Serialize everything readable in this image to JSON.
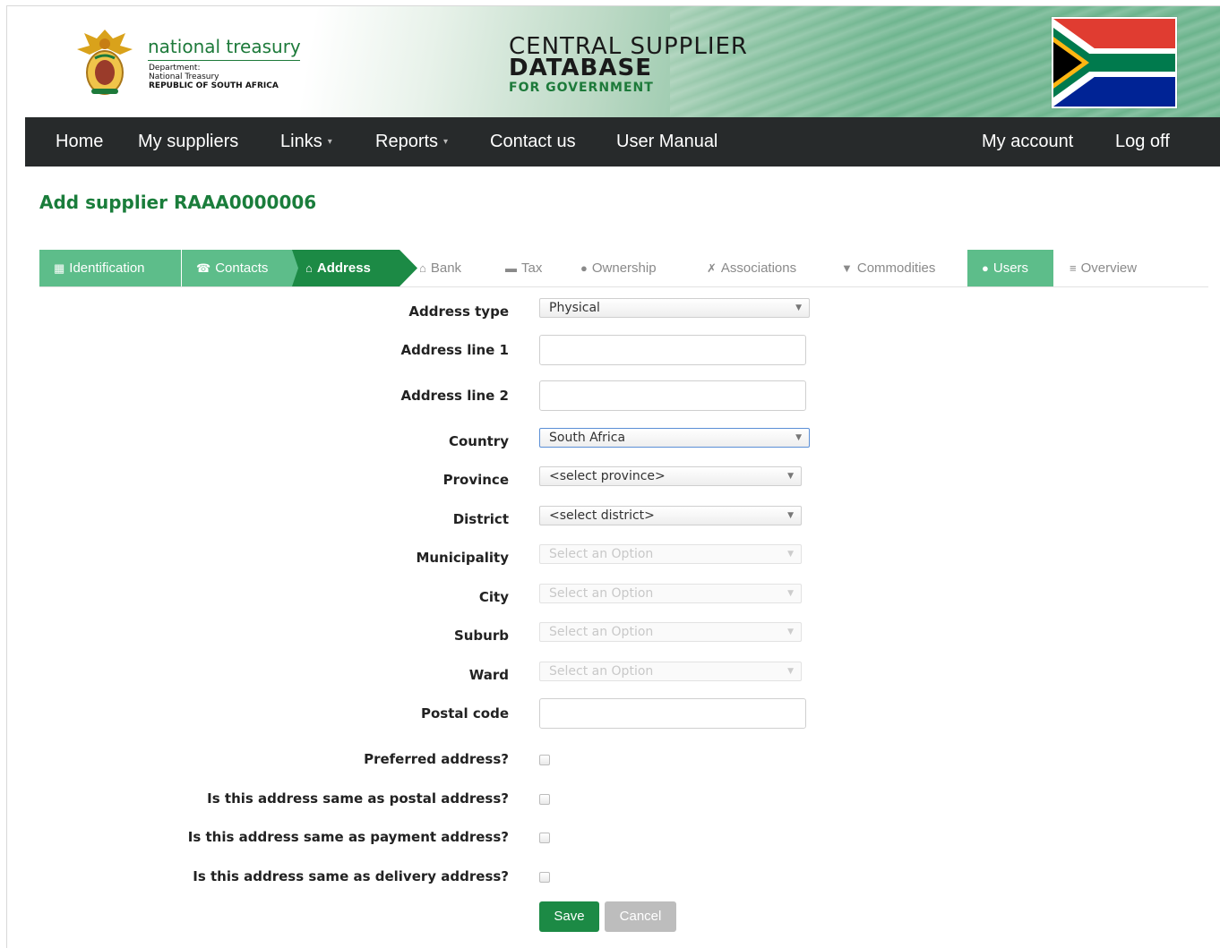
{
  "header": {
    "org_name": "national treasury",
    "org_sub1": "Department:",
    "org_sub2": "National Treasury",
    "org_sub3": "REPUBLIC OF SOUTH AFRICA",
    "csd_line1": "CENTRAL SUPPLIER",
    "csd_line2": "DATABASE",
    "csd_line3": "FOR GOVERNMENT"
  },
  "nav": {
    "home": "Home",
    "my_suppliers": "My suppliers",
    "links": "Links",
    "reports": "Reports",
    "contact": "Contact us",
    "manual": "User Manual",
    "account": "My account",
    "logoff": "Log off"
  },
  "page": {
    "title": "Add supplier RAAA0000006"
  },
  "steps": {
    "identification": "Identification",
    "contacts": "Contacts",
    "address": "Address",
    "bank": "Bank",
    "tax": "Tax",
    "ownership": "Ownership",
    "associations": "Associations",
    "commodities": "Commodities",
    "users": "Users",
    "overview": "Overview"
  },
  "form": {
    "address_type_label": "Address type",
    "address_type_value": "Physical",
    "line1_label": "Address line 1",
    "line2_label": "Address line 2",
    "country_label": "Country",
    "country_value": "South Africa",
    "province_label": "Province",
    "province_value": "<select province>",
    "district_label": "District",
    "district_value": "<select district>",
    "municipality_label": "Municipality",
    "city_label": "City",
    "suburb_label": "Suburb",
    "ward_label": "Ward",
    "option_placeholder": "Select an Option",
    "postal_label": "Postal code",
    "preferred_label": "Preferred address?",
    "same_postal_label": "Is this address same as postal address?",
    "same_payment_label": "Is this address same as payment address?",
    "same_delivery_label": "Is this address same as delivery address?"
  },
  "buttons": {
    "save": "Save",
    "cancel": "Cancel"
  },
  "colors": {
    "brand_green": "#1c8a45",
    "step_done": "#5dbd8a",
    "nav_bg": "#272a2b"
  }
}
